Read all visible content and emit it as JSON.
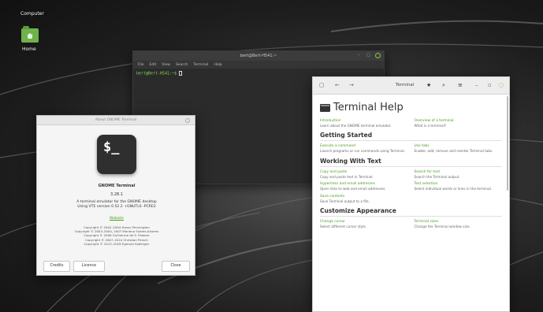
{
  "desktop": {
    "computer_label": "Computer",
    "home_label": "Home"
  },
  "terminal": {
    "title": "bert@Bert-H541:~",
    "menu": [
      "File",
      "Edit",
      "View",
      "Search",
      "Terminal",
      "Help"
    ],
    "prompt": "bert@Bert-H541:~$"
  },
  "about": {
    "title": "About GNOME Terminal",
    "icon_text": "$_",
    "app_name": "GNOME Terminal",
    "version": "3.28.1",
    "description": [
      "A terminal emulator for the GNOME desktop",
      "Using VTE version 0.52.2 +GNUTLS -PCRE2"
    ],
    "website": "Website",
    "copyright": [
      "Copyright © 2002–2004 Havoc Pennington",
      "Copyright © 2003–2004, 2007 Mariano Suárez-Alvarez",
      "Copyright © 2006 Guilherme de S. Pastore",
      "Copyright © 2007–2010 Christian Persch",
      "Copyright © 2013–2018 Egmont Koblinger"
    ],
    "buttons": {
      "credits": "Credits",
      "licence": "Licence",
      "close": "Close"
    }
  },
  "help": {
    "window_title": "Terminal",
    "page_title": "Terminal Help",
    "intro": [
      {
        "link": "Introduction",
        "desc": "Learn about the GNOME terminal emulator."
      },
      {
        "link": "Overview of a terminal",
        "desc": "What is a terminal?"
      }
    ],
    "sections": [
      {
        "title": "Getting Started",
        "items": [
          {
            "link": "Execute a command",
            "desc": "Launch programs or run commands using Terminal."
          },
          {
            "link": "Use tabs",
            "desc": "Enable, add, remove and reorder Terminal tabs."
          }
        ]
      },
      {
        "title": "Working With Text",
        "items": [
          {
            "link": "Copy and paste",
            "desc": "Copy and paste text in Terminal."
          },
          {
            "link": "Search for text",
            "desc": "Search the Terminal output."
          },
          {
            "link": "Hyperlinks and email addresses",
            "desc": "Open links to web and email addresses."
          },
          {
            "link": "Text selection",
            "desc": "Select individual words or lines in the terminal."
          },
          {
            "link": "Save contents",
            "desc": "Save Terminal output to a file."
          }
        ]
      },
      {
        "title": "Customize Appearance",
        "items": [
          {
            "link": "Change cursor",
            "desc": "Select different cursor style."
          },
          {
            "link": "Terminal sizes",
            "desc": "Change the Terminal window size."
          }
        ]
      }
    ]
  }
}
